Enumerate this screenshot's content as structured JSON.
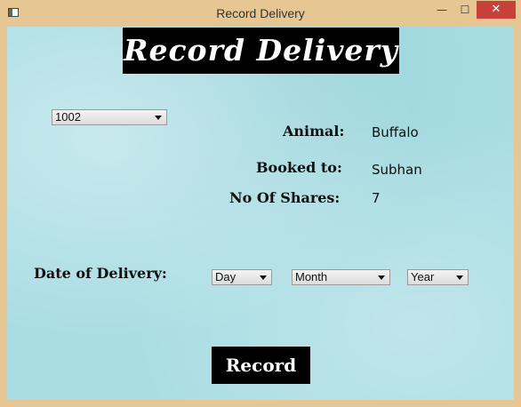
{
  "window": {
    "title": "Record Delivery",
    "minimize_glyph": "—",
    "maximize_glyph": "☐",
    "close_glyph": "✕"
  },
  "header": {
    "title": "Record Delivery"
  },
  "selector": {
    "selected_value": "1002"
  },
  "details": {
    "animal_label": "Animal:",
    "animal_value": "Buffalo",
    "booked_label": "Booked to:",
    "booked_value": "Subhan",
    "shares_label": "No Of Shares:",
    "shares_value": "7"
  },
  "delivery": {
    "label": "Date of Delivery:",
    "day": "Day",
    "month": "Month",
    "year": "Year"
  },
  "actions": {
    "record_label": "Record"
  },
  "colors": {
    "background": "#a9dde3",
    "frame": "#e6c793",
    "close_button": "#c7403a"
  }
}
